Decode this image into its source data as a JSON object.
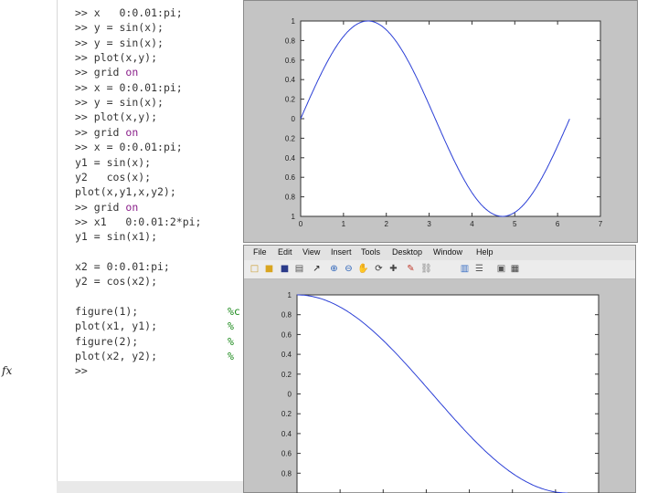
{
  "command_window": {
    "lines": [
      {
        "prompt": ">>",
        "code": " x   0:0.01:pi;"
      },
      {
        "prompt": ">>",
        "code": " y = sin(x);"
      },
      {
        "prompt": ">>",
        "code": " y = sin(x);"
      },
      {
        "prompt": ">>",
        "code": " plot(x,y);"
      },
      {
        "prompt": ">>",
        "code": " grid ",
        "keyword": "on"
      },
      {
        "prompt": ">>",
        "code": " x = 0:0.01:pi;"
      },
      {
        "prompt": ">>",
        "code": " y = sin(x);"
      },
      {
        "prompt": ">>",
        "code": " plot(x,y);"
      },
      {
        "prompt": ">>",
        "code": " grid ",
        "keyword": "on"
      },
      {
        "prompt": ">>",
        "code": " x = 0:0.01:pi;"
      },
      {
        "prompt": "",
        "code": "y1 = sin(x);"
      },
      {
        "prompt": "",
        "code": "y2   cos(x);"
      },
      {
        "prompt": "",
        "code": "plot(x,y1,x,y2);"
      },
      {
        "prompt": ">>",
        "code": " grid ",
        "keyword": "on"
      },
      {
        "prompt": ">>",
        "code": " x1   0:0.01:2*pi;"
      },
      {
        "prompt": "",
        "code": "y1 = sin(x1);"
      },
      {
        "prompt": "",
        "code": ""
      },
      {
        "prompt": "",
        "code": "x2 = 0:0.01:pi;"
      },
      {
        "prompt": "",
        "code": "y2 = cos(x2);"
      },
      {
        "prompt": "",
        "code": ""
      },
      {
        "prompt": "",
        "code": "figure(1);"
      },
      {
        "prompt": "",
        "code": "plot(x1, y1);"
      },
      {
        "prompt": "",
        "code": "figure(2);"
      },
      {
        "prompt": "",
        "code": "plot(x2, y2);"
      },
      {
        "prompt": ">>",
        "code": ""
      }
    ],
    "comments": [
      "%c",
      "%",
      "%",
      "%"
    ],
    "fx_label": "fx"
  },
  "figure2": {
    "menu": [
      "File",
      "Edit",
      "View",
      "Insert",
      "Tools",
      "Desktop",
      "Window",
      "Help"
    ],
    "toolbar_icons": [
      "new-figure-icon",
      "open-file-icon",
      "save-icon",
      "print-icon",
      "edit-plot-icon",
      "zoom-in-icon",
      "zoom-out-icon",
      "pan-icon",
      "rotate-icon",
      "data-cursor-icon",
      "brush-icon",
      "link-icon",
      "colorbar-icon",
      "legend-icon",
      "hide-plot-tools-icon",
      "show-plot-tools-icon"
    ],
    "colors": {
      "line": "#2b3fd6"
    }
  },
  "chart_data": [
    {
      "type": "line",
      "title": "",
      "xlabel": "",
      "ylabel": "",
      "series": [
        {
          "function": "sin(x)",
          "x_range": [
            0,
            6.28
          ],
          "step": 0.01
        }
      ],
      "xlim": [
        0,
        7
      ],
      "ylim": [
        -1,
        1
      ],
      "xticks": [
        "0",
        "1",
        "2",
        "3",
        "4",
        "5",
        "6",
        "7"
      ],
      "yticks": [
        "1",
        "0.8",
        "0.6",
        "0.4",
        "0.2",
        "0",
        "0.2",
        "0.4",
        "0.6",
        "0.8",
        "1"
      ],
      "grid": false
    },
    {
      "type": "line",
      "title": "",
      "xlabel": "",
      "ylabel": "",
      "series": [
        {
          "function": "cos(x)",
          "x_range": [
            0,
            3.14
          ],
          "step": 0.01
        }
      ],
      "xlim": [
        0,
        3.5
      ],
      "ylim": [
        -1,
        1
      ],
      "yticks": [
        "1",
        "0.8",
        "0.6",
        "0.4",
        "0.2",
        "0",
        "0.2",
        "0.4",
        "0.6",
        "0.8"
      ],
      "grid": false
    }
  ]
}
